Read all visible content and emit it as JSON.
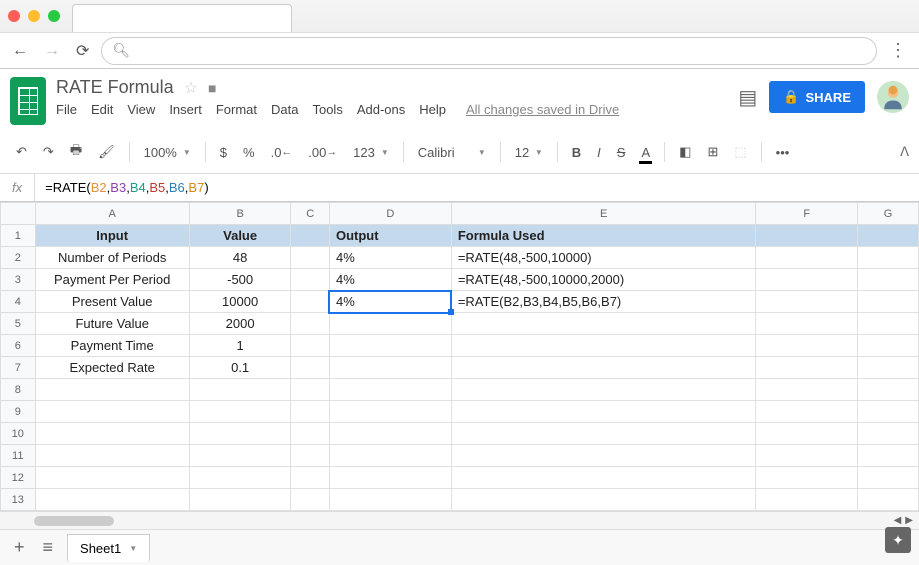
{
  "doc": {
    "title": "RATE Formula",
    "save_status": "All changes saved in Drive"
  },
  "menus": [
    "File",
    "Edit",
    "View",
    "Insert",
    "Format",
    "Data",
    "Tools",
    "Add-ons",
    "Help"
  ],
  "toolbar": {
    "zoom": "100%",
    "currency": "$",
    "percent": "%",
    "dec_dec": ".0",
    "dec_inc": ".00",
    "fmt123": "123",
    "font": "Calibri",
    "size": "12",
    "bold": "B",
    "italic": "I",
    "strike": "S",
    "textcolor": "A",
    "more": "•••"
  },
  "share_label": "SHARE",
  "formula": {
    "fx": "fx",
    "prefix": "=RATE(",
    "b2": "B2",
    "b3": "B3",
    "b4": "B4",
    "b5": "B5",
    "b6": "B6",
    "b7": "B7",
    "suffix": ")",
    "comma": ","
  },
  "columns": [
    "A",
    "B",
    "C",
    "D",
    "E",
    "F",
    "G"
  ],
  "row_headers": [
    "1",
    "2",
    "3",
    "4",
    "5",
    "6",
    "7",
    "8",
    "9",
    "10",
    "11",
    "12",
    "13"
  ],
  "sheet": {
    "header": {
      "a": "Input",
      "b": "Value",
      "d": "Output",
      "e": "Formula Used"
    },
    "rows": [
      {
        "a": "Number of Periods",
        "b": "48",
        "d": "4%",
        "e": "=RATE(48,-500,10000)"
      },
      {
        "a": "Payment Per Period",
        "b": "-500",
        "d": "4%",
        "e": "=RATE(48,-500,10000,2000)"
      },
      {
        "a": "Present Value",
        "b": "10000",
        "d": "4%",
        "e": "=RATE(B2,B3,B4,B5,B6,B7)"
      },
      {
        "a": "Future Value",
        "b": "2000",
        "d": "",
        "e": ""
      },
      {
        "a": "Payment Time",
        "b": "1",
        "d": "",
        "e": ""
      },
      {
        "a": "Expected Rate",
        "b": "0.1",
        "d": "",
        "e": ""
      }
    ]
  },
  "tabs": {
    "sheet1": "Sheet1"
  }
}
